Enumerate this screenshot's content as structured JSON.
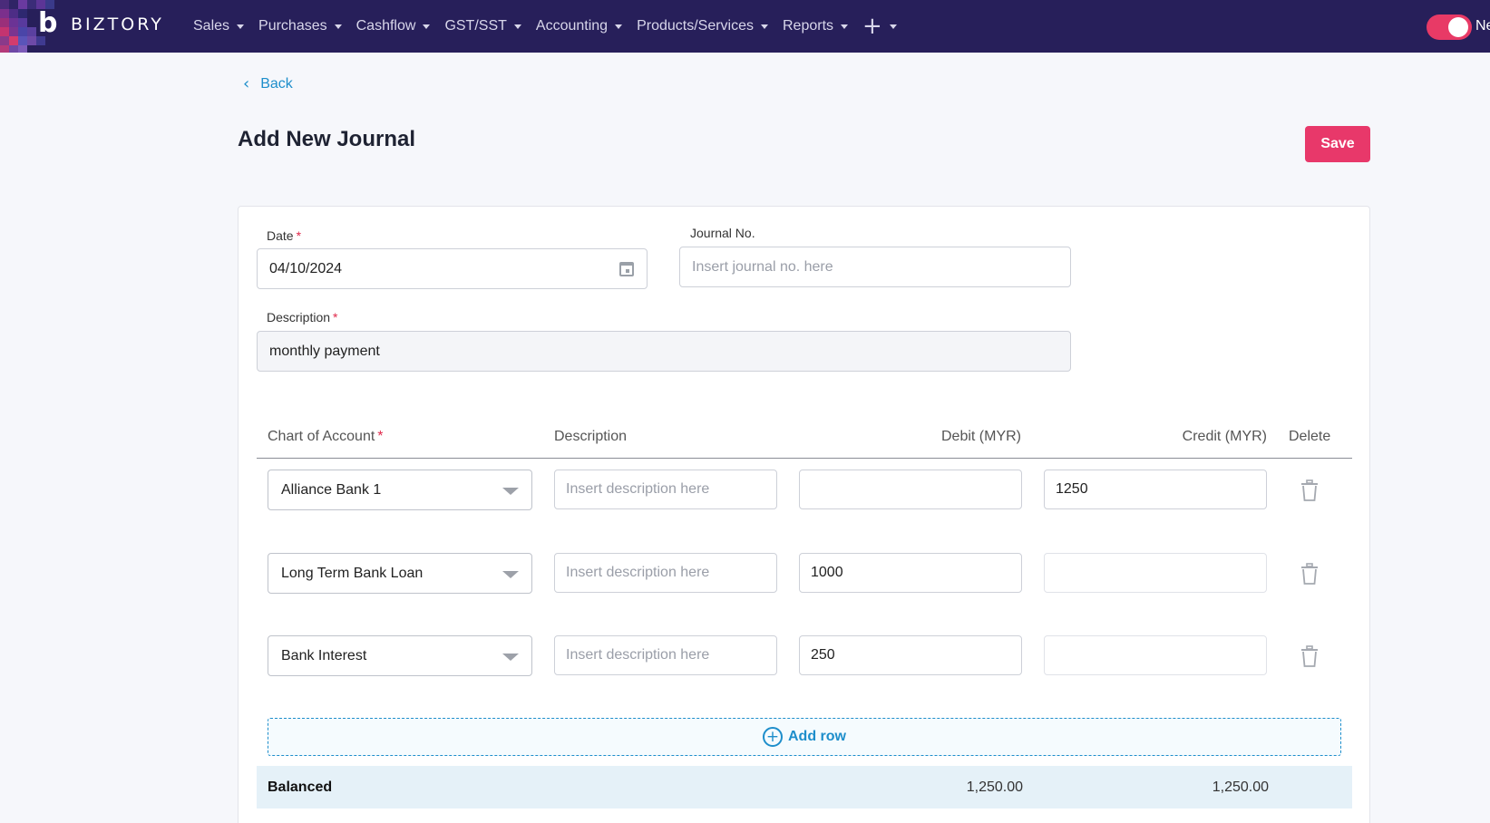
{
  "brand": {
    "mark": "b",
    "name": "BIZTORY"
  },
  "nav": {
    "items": [
      {
        "label": "Sales"
      },
      {
        "label": "Purchases"
      },
      {
        "label": "Cashflow"
      },
      {
        "label": "GST/SST"
      },
      {
        "label": "Accounting"
      },
      {
        "label": "Products/Services"
      },
      {
        "label": "Reports"
      }
    ],
    "plus_icon": "+",
    "toggle_text": "Ne"
  },
  "page": {
    "back_label": "Back",
    "title": "Add New Journal",
    "save_label": "Save"
  },
  "form": {
    "date_label": "Date",
    "date_value": "04/10/2024",
    "journal_no_label": "Journal No.",
    "journal_no_placeholder": "Insert journal no. here",
    "description_label": "Description",
    "description_value": "monthly payment",
    "required_mark": "*"
  },
  "table": {
    "headers": {
      "account": "Chart of Account",
      "description": "Description",
      "debit": "Debit (MYR)",
      "credit": "Credit (MYR)",
      "delete": "Delete"
    },
    "description_placeholder": "Insert description here",
    "rows": [
      {
        "account": "Alliance Bank 1",
        "debit": "",
        "credit": "1250"
      },
      {
        "account": "Long Term Bank Loan",
        "debit": "1000",
        "credit": ""
      },
      {
        "account": "Bank Interest",
        "debit": "250",
        "credit": ""
      }
    ],
    "add_row_label": "Add row",
    "summary": {
      "label": "Balanced",
      "debit_total": "1,250.00",
      "credit_total": "1,250.00"
    }
  },
  "colors": {
    "nav_bg": "#271f5a",
    "accent": "#e8386a",
    "link": "#1e8ecb"
  }
}
